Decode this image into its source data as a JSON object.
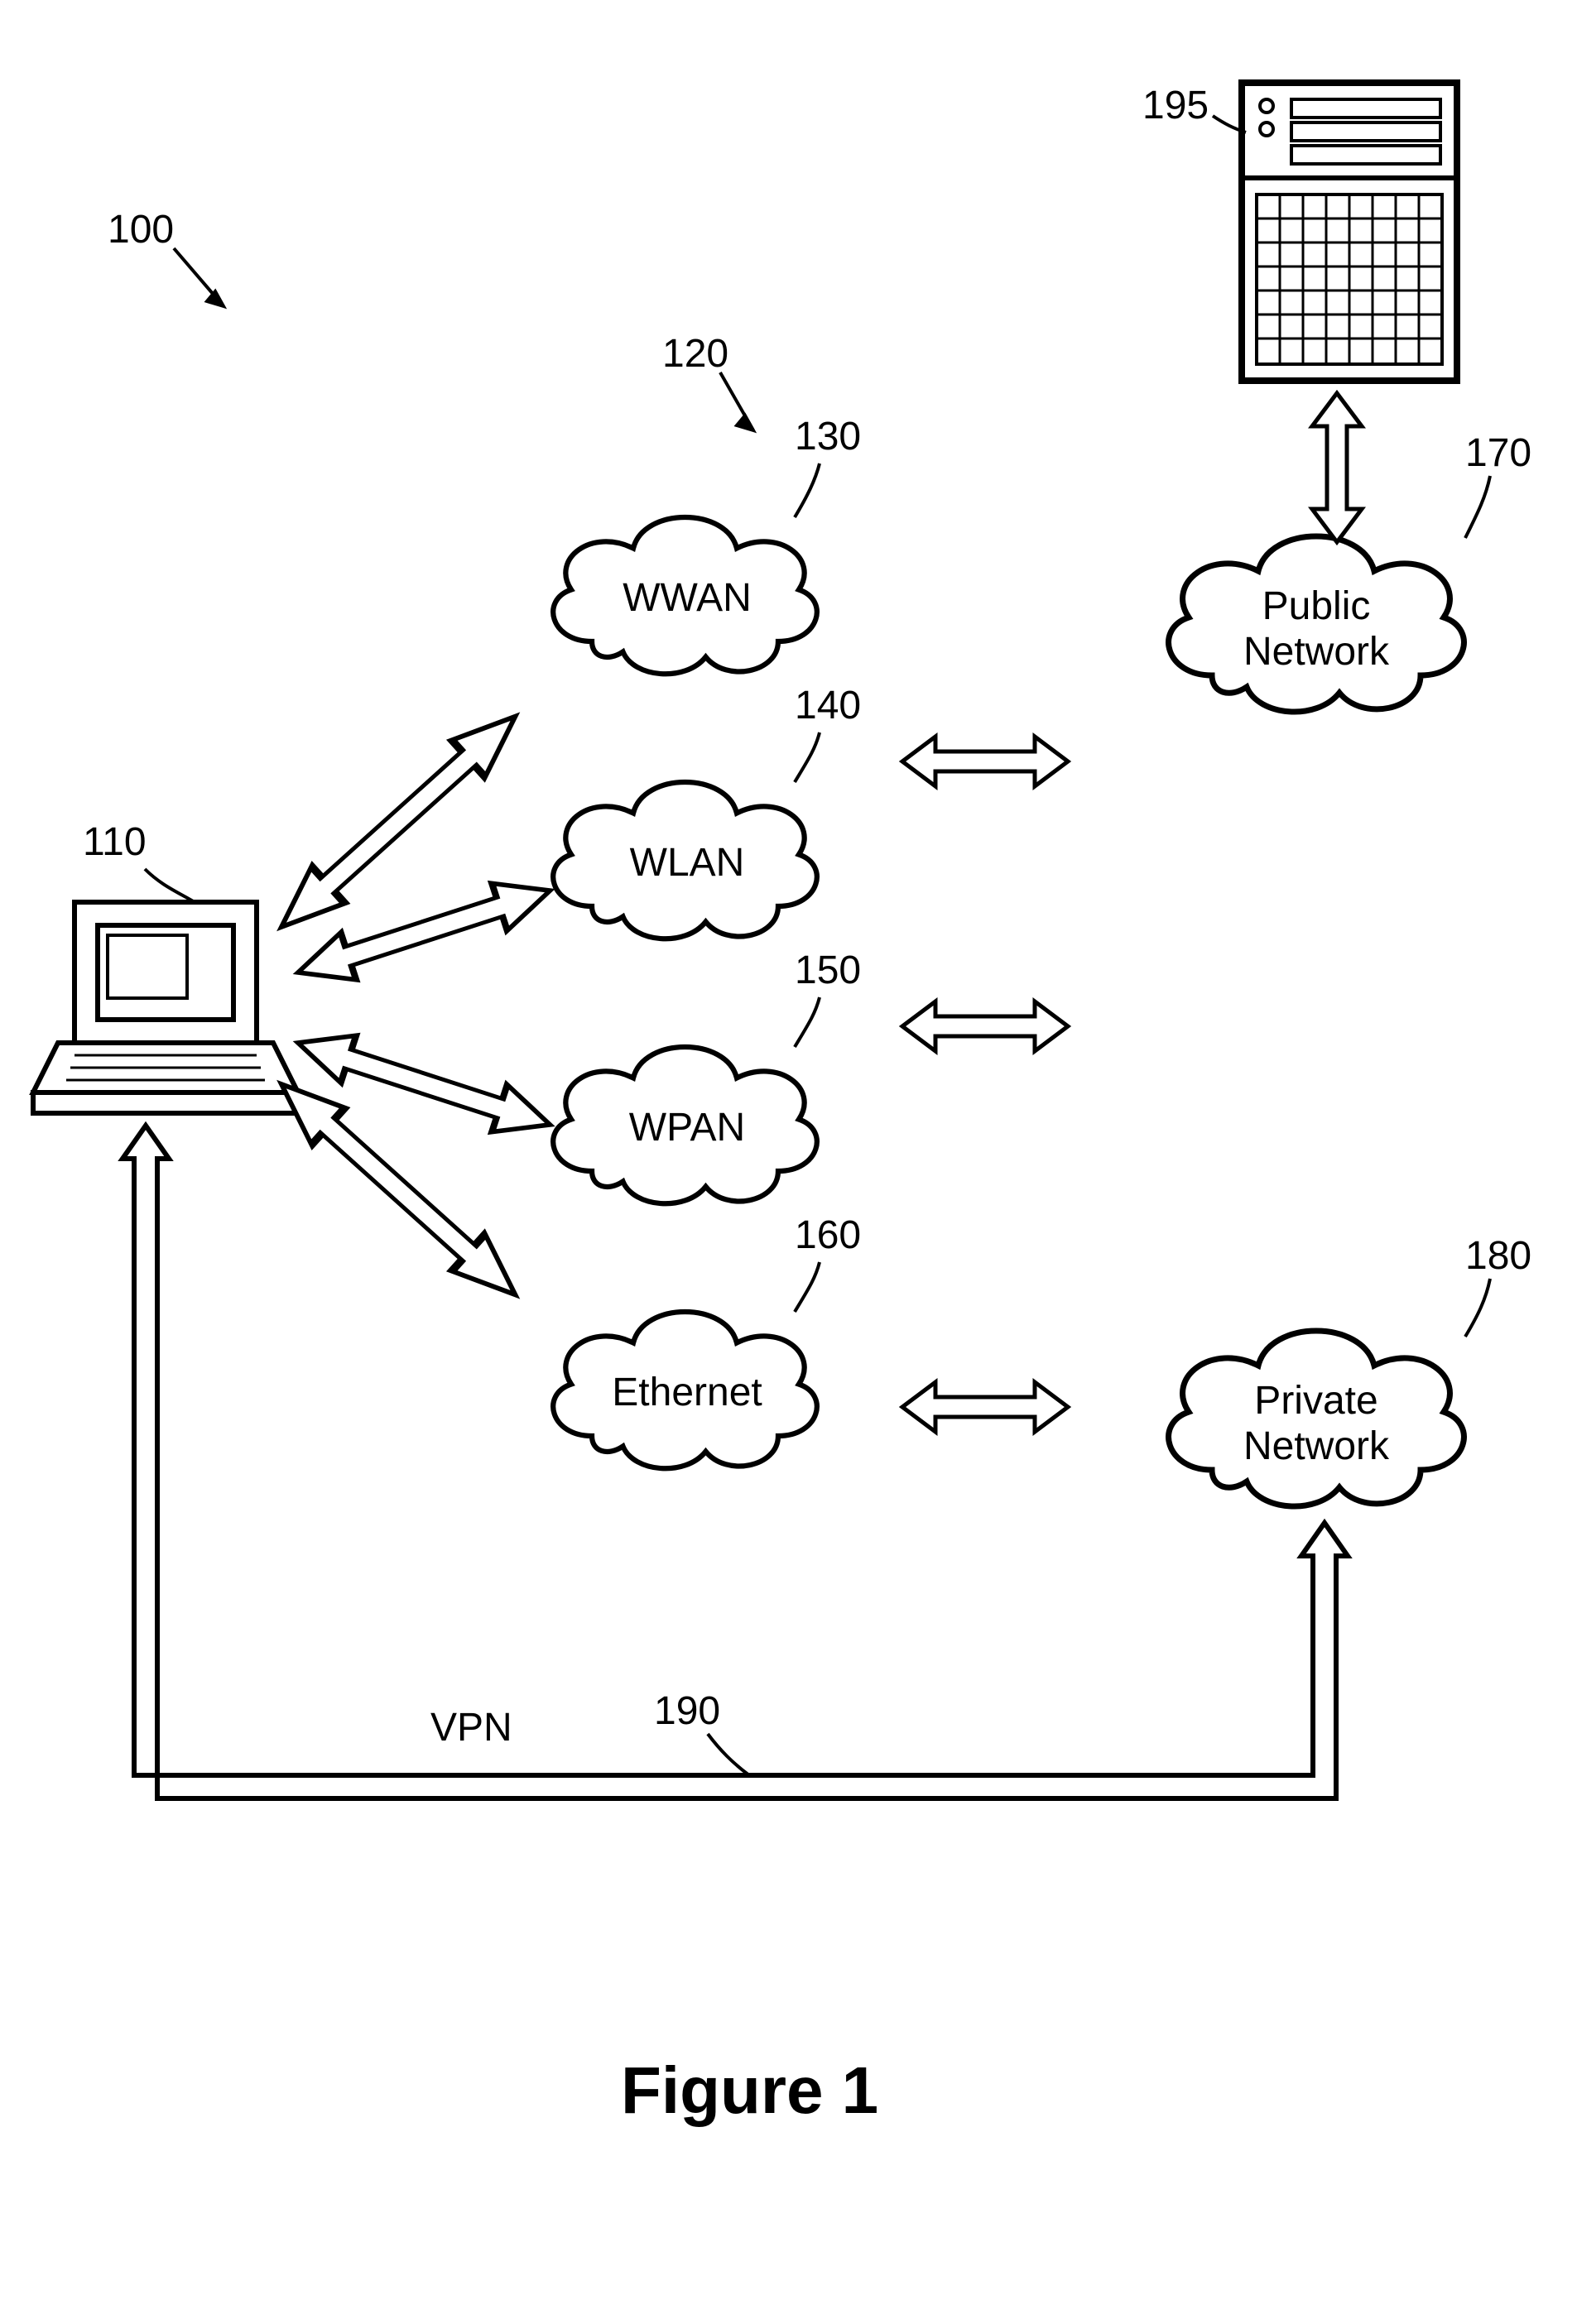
{
  "figure": {
    "title": "Figure 1",
    "ref_main": "100",
    "ref_group": "120",
    "vpn_label": "VPN",
    "vpn_ref": "190"
  },
  "laptop": {
    "ref": "110"
  },
  "server": {
    "ref": "195"
  },
  "clouds": {
    "wwan": {
      "ref": "130",
      "label": "WWAN"
    },
    "wlan": {
      "ref": "140",
      "label": "WLAN"
    },
    "wpan": {
      "ref": "150",
      "label": "WPAN"
    },
    "ethernet": {
      "ref": "160",
      "label": "Ethernet"
    },
    "public": {
      "ref": "170",
      "label": "Public\nNetwork"
    },
    "private": {
      "ref": "180",
      "label": "Private\nNetwork"
    }
  }
}
